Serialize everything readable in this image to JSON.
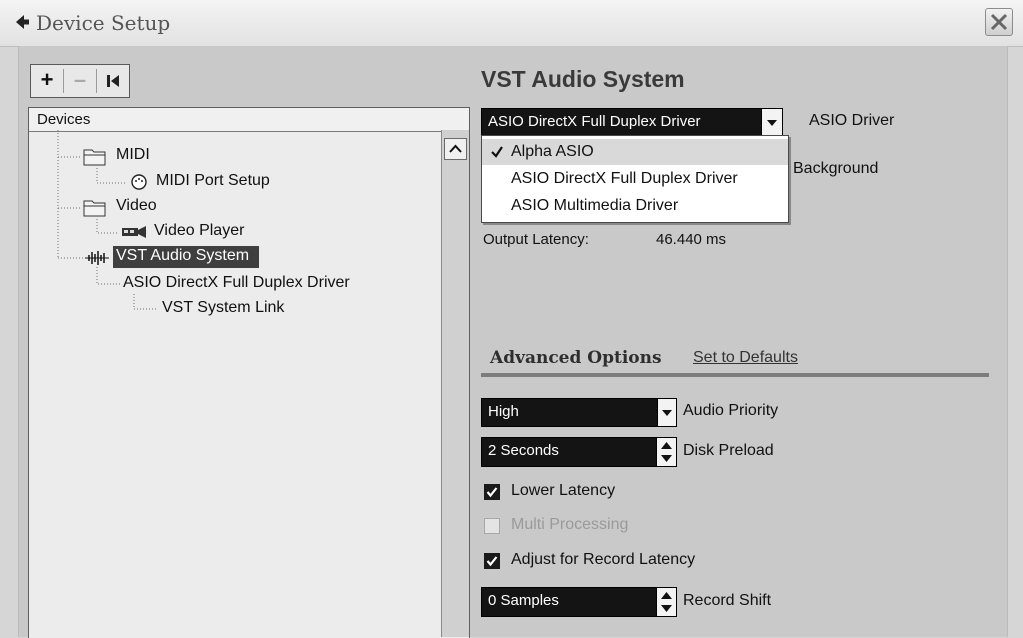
{
  "window": {
    "title": "Device Setup",
    "back_icon": "back-arrow-icon",
    "close_icon": "close-icon"
  },
  "toolbar": {
    "add_label": "+",
    "remove_label": "–",
    "reset_icon": "reset-icon"
  },
  "tree": {
    "header": "Devices",
    "nodes": [
      {
        "label": "MIDI",
        "icon": "folder-icon"
      },
      {
        "label": "MIDI Port Setup",
        "icon": "midi-port-icon"
      },
      {
        "label": "Video",
        "icon": "folder-icon"
      },
      {
        "label": "Video Player",
        "icon": "video-player-icon"
      },
      {
        "label": "VST Audio System",
        "icon": "audio-wave-icon",
        "selected": true
      },
      {
        "label": "ASIO DirectX Full Duplex Driver"
      },
      {
        "label": "VST System Link"
      }
    ]
  },
  "panel": {
    "heading": "VST Audio System",
    "asio_driver": {
      "value": "ASIO DirectX Full Duplex Driver",
      "label": "ASIO Driver",
      "options": [
        "Alpha ASIO",
        "ASIO DirectX Full Duplex Driver",
        "ASIO Multimedia Driver"
      ],
      "checked_option": "Alpha ASIO"
    },
    "background_label": "Background",
    "output_latency": {
      "label": "Output Latency:",
      "value": "46.440 ms"
    },
    "advanced": {
      "title": "Advanced Options",
      "defaults_link": "Set to Defaults",
      "audio_priority": {
        "value": "High",
        "label": "Audio Priority"
      },
      "disk_preload": {
        "value": "2 Seconds",
        "label": "Disk Preload"
      },
      "lower_latency": {
        "label": "Lower Latency",
        "checked": true
      },
      "multi_processing": {
        "label": "Multi Processing",
        "checked": false,
        "disabled": true
      },
      "adjust_record_latency": {
        "label": "Adjust for Record Latency",
        "checked": true
      },
      "record_shift": {
        "value": "0 Samples",
        "label": "Record Shift"
      }
    }
  }
}
